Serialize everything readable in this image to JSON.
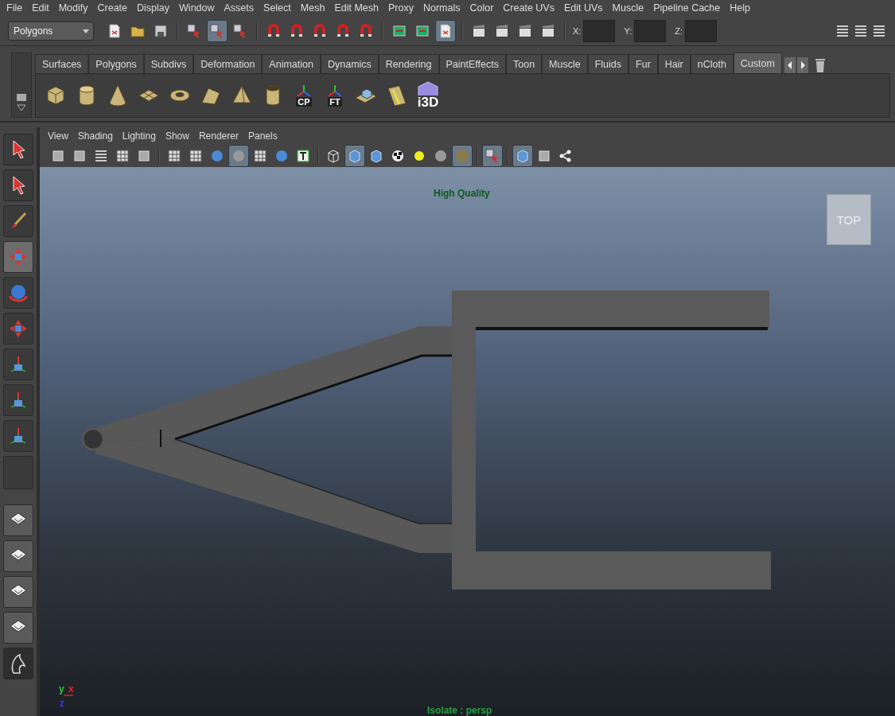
{
  "menu_bar": [
    "File",
    "Edit",
    "Modify",
    "Create",
    "Display",
    "Window",
    "Assets",
    "Select",
    "Mesh",
    "Edit Mesh",
    "Proxy",
    "Normals",
    "Color",
    "Create UVs",
    "Edit UVs",
    "Muscle",
    "Pipeline Cache",
    "Help"
  ],
  "status_line": {
    "mode": "Polygons",
    "buttons": [
      {
        "selected": false
      },
      {
        "selected": false
      },
      {
        "selected": false
      },
      {
        "selected": false
      },
      {
        "selected": true
      },
      {
        "selected": false
      },
      {
        "selected": false
      },
      {
        "selected": false
      },
      {
        "selected": false
      },
      {
        "selected": false
      },
      {
        "selected": false
      },
      {
        "selected": false
      },
      {
        "selected": false
      },
      {
        "selected": true
      },
      {
        "selected": false
      },
      {
        "selected": false
      },
      {
        "selected": false
      },
      {
        "selected": false
      }
    ],
    "coordinates": [
      "X:",
      "Y:",
      "Z:"
    ]
  },
  "shelf": {
    "tabs": [
      {
        "label": "Surfaces",
        "selected": false
      },
      {
        "label": "Polygons",
        "selected": false
      },
      {
        "label": "Subdivs",
        "selected": false
      },
      {
        "label": "Deformation",
        "selected": false
      },
      {
        "label": "Animation",
        "selected": false
      },
      {
        "label": "Dynamics",
        "selected": false
      },
      {
        "label": "Rendering",
        "selected": false
      },
      {
        "label": "PaintEffects",
        "selected": false
      },
      {
        "label": "Toon",
        "selected": false
      },
      {
        "label": "Muscle",
        "selected": false
      },
      {
        "label": "Fluids",
        "selected": false
      },
      {
        "label": "Fur",
        "selected": false
      },
      {
        "label": "Hair",
        "selected": false
      },
      {
        "label": "nCloth",
        "selected": false
      },
      {
        "label": "Custom",
        "selected": true
      }
    ],
    "items": [
      {
        "kind": "cube"
      },
      {
        "kind": "cylinder"
      },
      {
        "kind": "cone"
      },
      {
        "kind": "plane"
      },
      {
        "kind": "torus"
      },
      {
        "kind": "prism"
      },
      {
        "kind": "pyramid"
      },
      {
        "kind": "pipe"
      },
      {
        "kind": "axes",
        "label": "CP"
      },
      {
        "kind": "axes",
        "label": "FT"
      },
      {
        "kind": "boxplane"
      },
      {
        "kind": "ruler"
      },
      {
        "kind": "logo",
        "label": "i3D"
      }
    ]
  },
  "panel": {
    "menus": [
      "View",
      "Shading",
      "Lighting",
      "Show",
      "Renderer",
      "Panels"
    ],
    "buttons": [
      {
        "selected": false
      },
      {
        "selected": false
      },
      {
        "selected": false
      },
      {
        "selected": false
      },
      {
        "selected": false
      },
      {
        "selected": false
      },
      {
        "selected": false
      },
      {
        "selected": false
      },
      {
        "selected": true
      },
      {
        "selected": false
      },
      {
        "selected": false
      },
      {
        "selected": false
      },
      {
        "selected": false
      },
      {
        "selected": true
      },
      {
        "selected": false
      },
      {
        "selected": false
      },
      {
        "selected": false
      },
      {
        "selected": false
      },
      {
        "selected": true
      },
      {
        "selected": true
      },
      {
        "selected": true
      },
      {
        "selected": false
      },
      {
        "selected": false
      }
    ]
  },
  "toolbox": [
    {
      "selected": false
    },
    {
      "selected": false
    },
    {
      "selected": false
    },
    {
      "selected": true
    },
    {
      "selected": false
    },
    {
      "selected": false
    },
    {
      "selected": false
    },
    {
      "selected": false
    },
    {
      "selected": false
    }
  ],
  "viewport": {
    "hud_title": "High Quality",
    "view_cube": "TOP",
    "axis_labels": [
      "y",
      "x",
      "z"
    ],
    "status": "Isolate : persp"
  }
}
